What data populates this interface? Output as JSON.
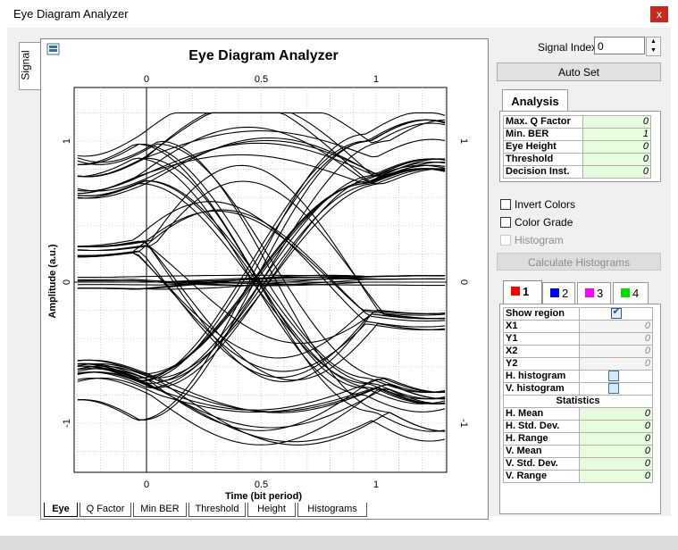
{
  "window": {
    "title": "Eye Diagram Analyzer",
    "close_glyph": "x"
  },
  "side_tab": {
    "label": "Signal"
  },
  "plot": {
    "title": "Eye Diagram Analyzer",
    "x_label": "Time (bit period)",
    "y_label": "Amplitude (a.u.)",
    "x_ticks": [
      "0",
      "0.5",
      "1"
    ],
    "y_ticks": [
      "1",
      "0",
      "-1"
    ],
    "icon": "chart-icon"
  },
  "bottom_tabs": [
    "Eye",
    "Q Factor",
    "Min BER",
    "Threshold",
    "Height",
    "Histograms"
  ],
  "controls": {
    "signal_index_label": "Signal Index:",
    "signal_index_value": "0",
    "auto_set_label": "Auto Set",
    "analysis_tab": "Analysis",
    "analysis": [
      {
        "label": "Max. Q Factor",
        "value": "0"
      },
      {
        "label": "Min. BER",
        "value": "1"
      },
      {
        "label": "Eye Height",
        "value": "0"
      },
      {
        "label": "Threshold",
        "value": "0"
      },
      {
        "label": "Decision Inst.",
        "value": "0"
      }
    ],
    "invert_colors": "Invert Colors",
    "color_grade": "Color Grade",
    "histogram": "Histogram",
    "calc_hist": "Calculate Histograms"
  },
  "channel_tabs": [
    {
      "label": "1",
      "color": "#ff0000"
    },
    {
      "label": "2",
      "color": "#0000ff"
    },
    {
      "label": "3",
      "color": "#ff00ff"
    },
    {
      "label": "4",
      "color": "#00dd00"
    }
  ],
  "region": {
    "show_region": "Show region",
    "rows": [
      {
        "label": "X1",
        "value": "0"
      },
      {
        "label": "Y1",
        "value": "0"
      },
      {
        "label": "X2",
        "value": "0"
      },
      {
        "label": "Y2",
        "value": "0"
      }
    ],
    "h_hist": "H. histogram",
    "v_hist": "V. histogram",
    "statistics": "Statistics",
    "stats": [
      {
        "label": "H. Mean",
        "value": "0"
      },
      {
        "label": "H. Std. Dev.",
        "value": "0"
      },
      {
        "label": "H. Range",
        "value": "0"
      },
      {
        "label": "V. Mean",
        "value": "0"
      },
      {
        "label": "V. Std. Dev.",
        "value": "0"
      },
      {
        "label": "V. Range",
        "value": "0"
      }
    ]
  }
}
